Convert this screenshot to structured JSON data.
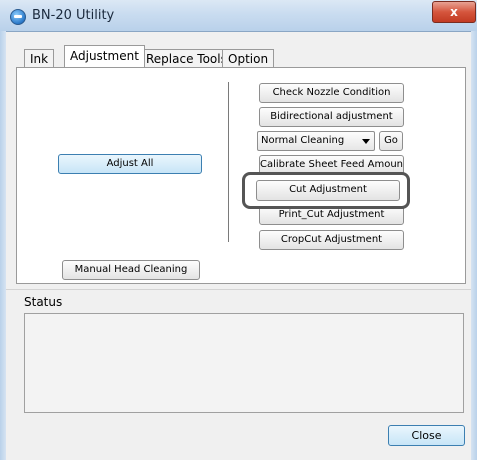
{
  "window": {
    "title": "BN-20 Utility",
    "close_glyph": "x"
  },
  "tabs": [
    {
      "label": "Ink",
      "active": false
    },
    {
      "label": "Adjustment",
      "active": true
    },
    {
      "label": "Replace Tools",
      "active": false
    },
    {
      "label": "Option",
      "active": false
    }
  ],
  "adjustment": {
    "adjust_all": "Adjust All",
    "manual_head_cleaning": "Manual Head Cleaning",
    "check_nozzle": "Check Nozzle Condition",
    "bidirectional": "Bidirectional adjustment",
    "cleaning_select": {
      "value": "Normal Cleaning"
    },
    "go": "Go",
    "calibrate": "Calibrate Sheet Feed Amount",
    "cut_adjustment": "Cut Adjustment",
    "print_cut": "Print_Cut Adjustment",
    "cropcut": "CropCut Adjustment"
  },
  "status": {
    "label": "Status",
    "text": ""
  },
  "footer": {
    "close": "Close"
  },
  "colors": {
    "highlight_border": "#555555",
    "focus_border": "#3c7fb1"
  }
}
